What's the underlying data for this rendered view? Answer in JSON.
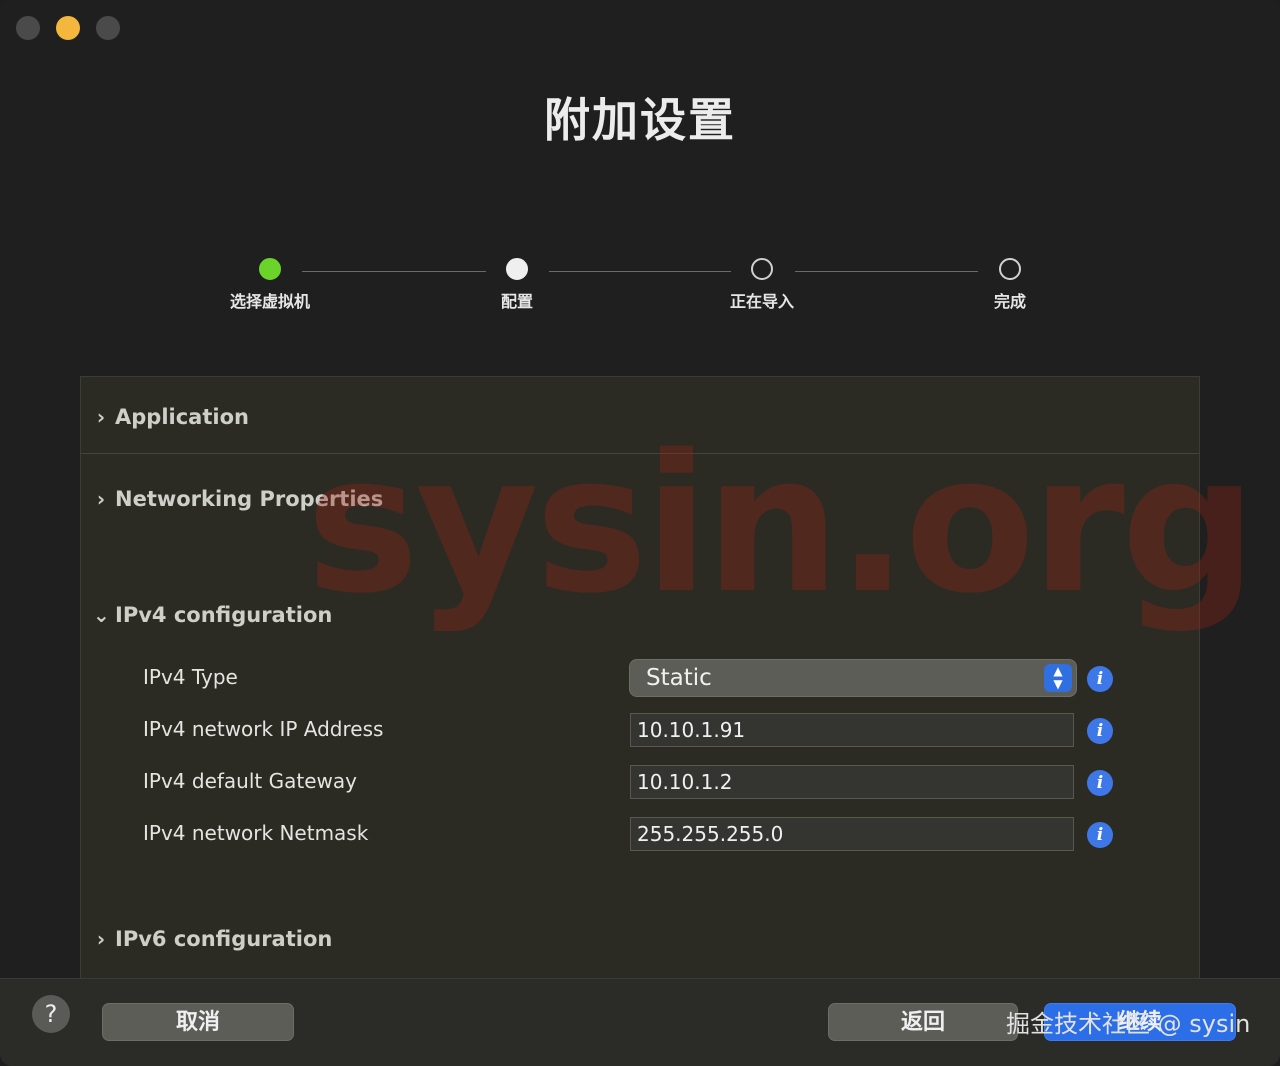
{
  "window": {
    "title": "附加设置"
  },
  "steps": [
    {
      "label": "选择虚拟机",
      "state": "done"
    },
    {
      "label": "配置",
      "state": "current"
    },
    {
      "label": "正在导入",
      "state": "pending"
    },
    {
      "label": "完成",
      "state": "pending"
    }
  ],
  "sections": {
    "application": "Application",
    "networking": "Networking Properties",
    "ipv4": "IPv4 configuration",
    "ipv6": "IPv6 configuration"
  },
  "ipv4": {
    "type_label": "IPv4 Type",
    "type_value": "Static",
    "address_label": "IPv4 network IP Address",
    "address_value": "10.10.1.91",
    "gateway_label": "IPv4 default Gateway",
    "gateway_value": "10.10.1.2",
    "netmask_label": "IPv4 network Netmask",
    "netmask_value": "255.255.255.0"
  },
  "footer": {
    "help": "?",
    "cancel": "取消",
    "back": "返回",
    "continue": "继续",
    "overlay_text": "掘金技术社区 @ sysin"
  },
  "watermark": "sysin.org",
  "colors": {
    "accent": "#2c6ee8",
    "done": "#6bd42a",
    "info": "#3e78e8"
  }
}
